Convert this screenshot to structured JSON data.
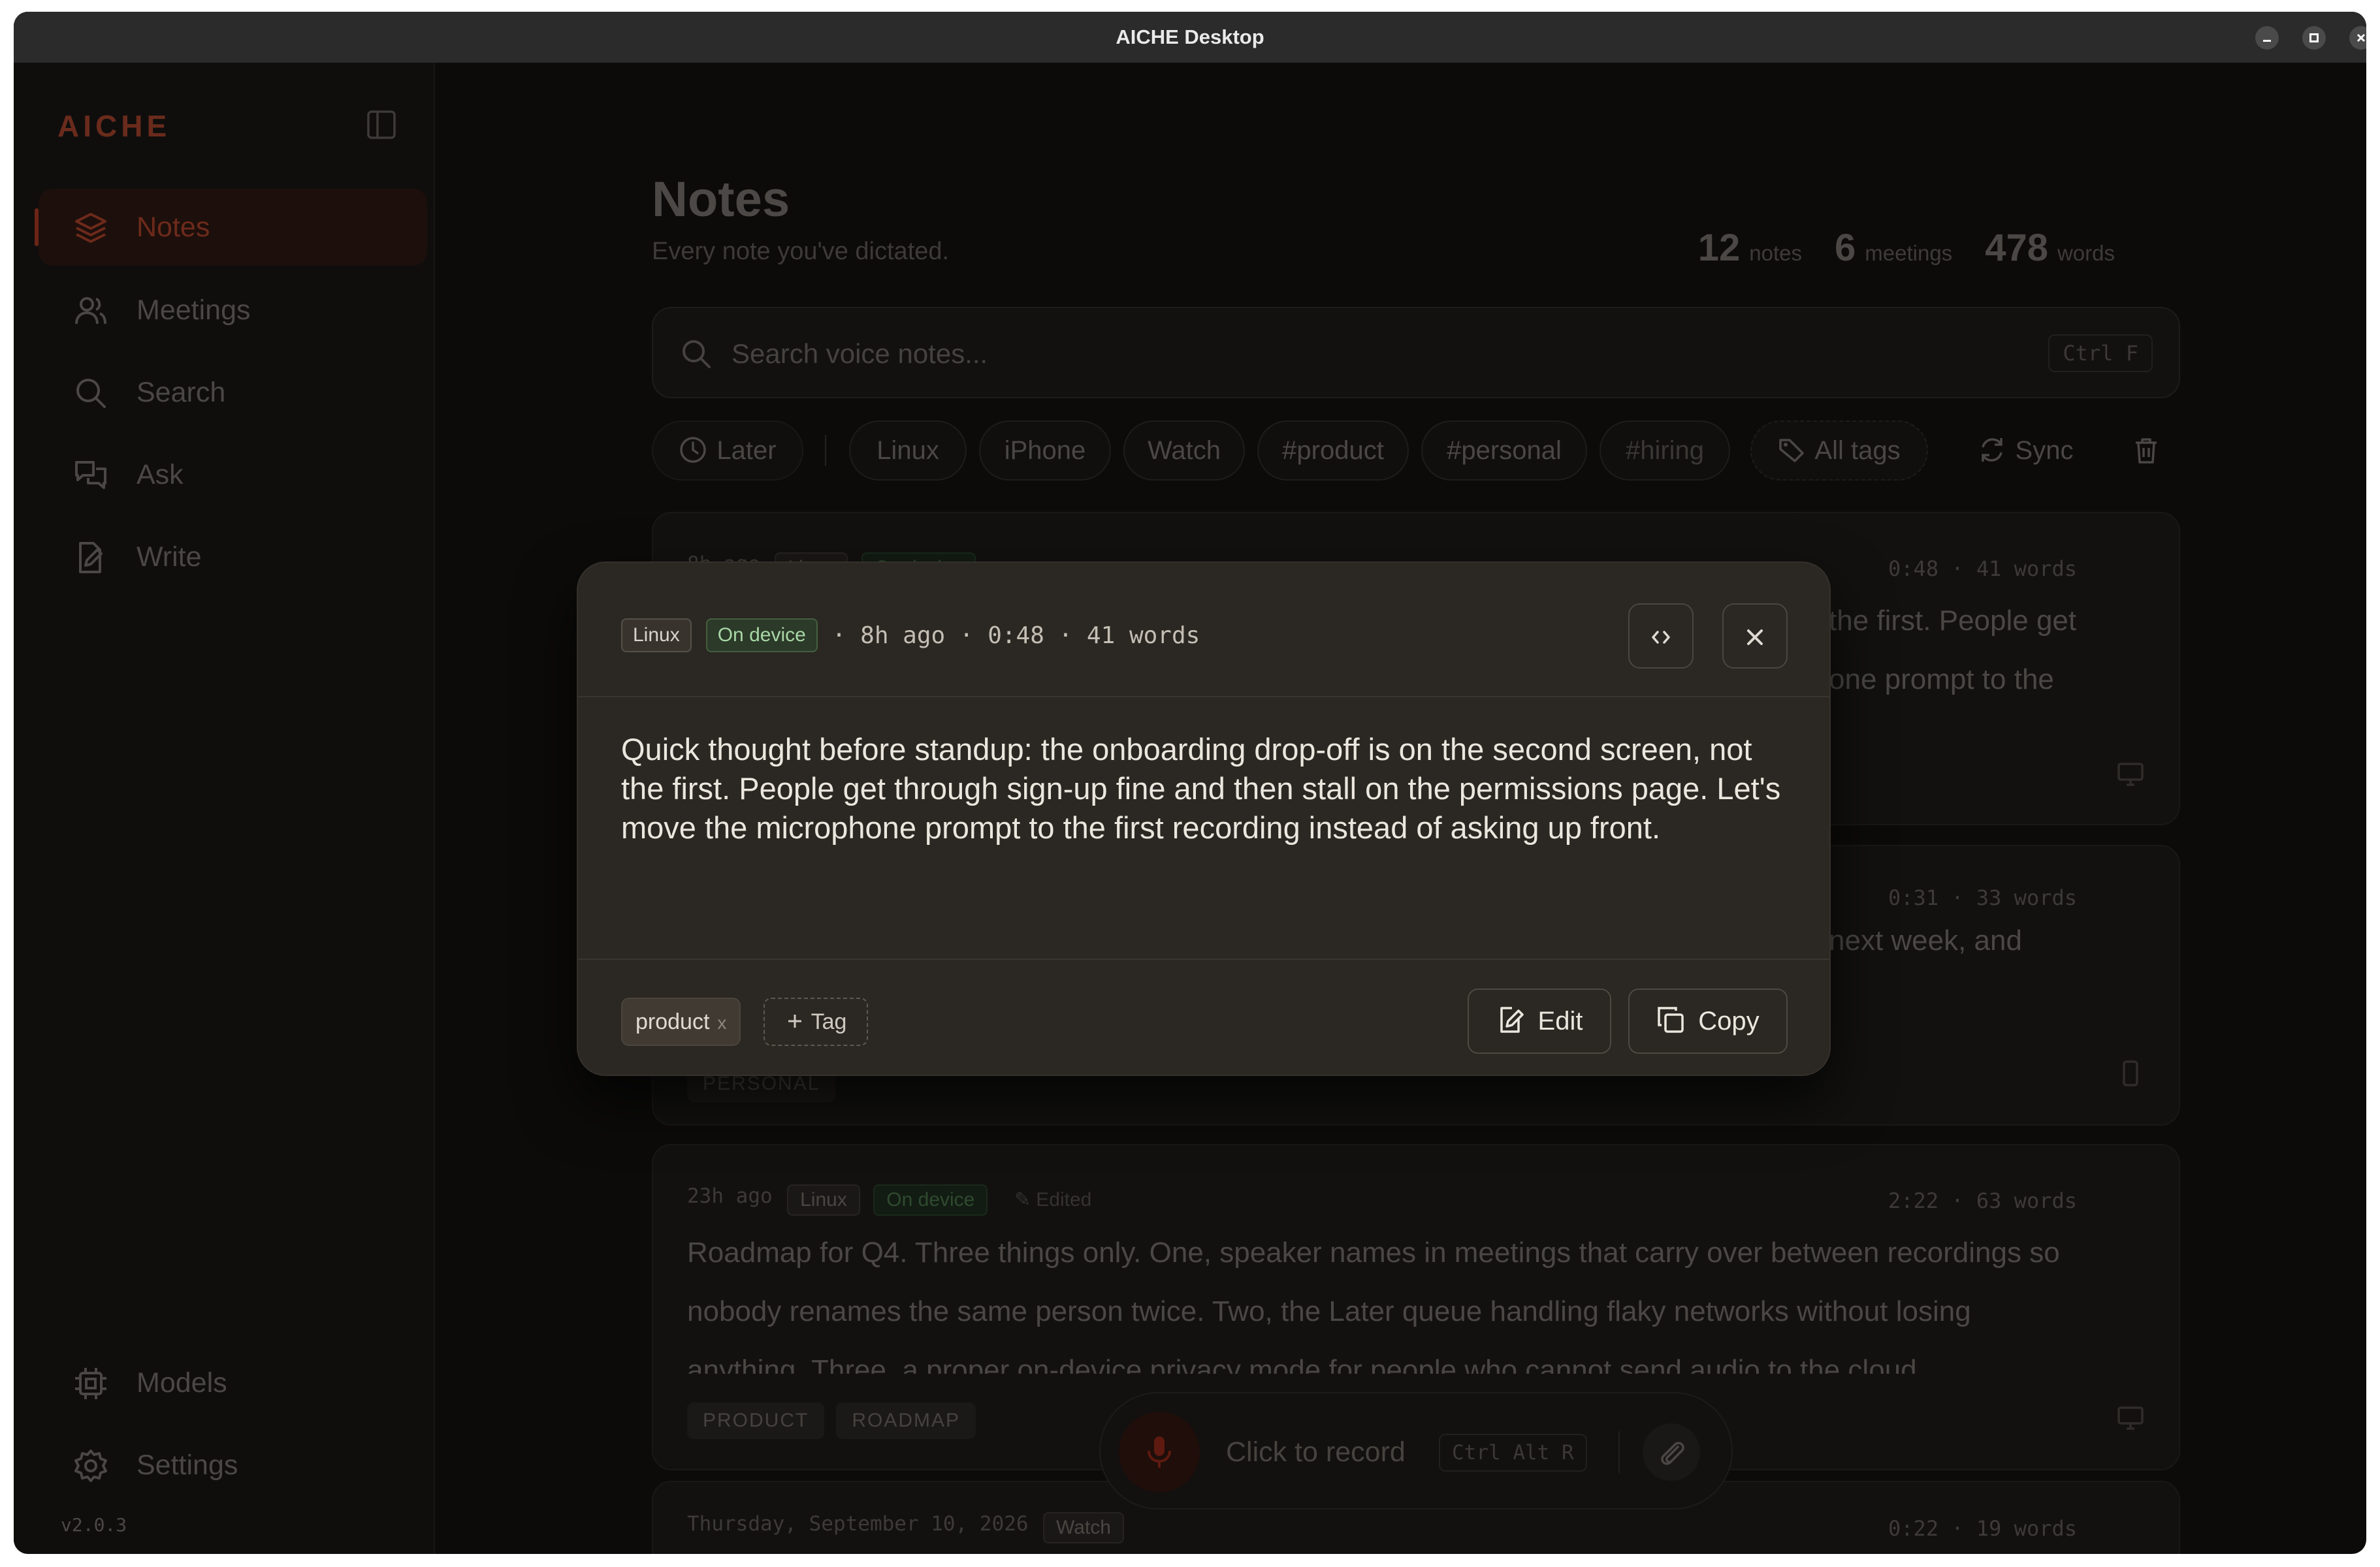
{
  "window": {
    "title": "AICHE Desktop",
    "minimize_label": "–",
    "close_label": "×"
  },
  "sidebar": {
    "logo": "AICHE",
    "items": [
      {
        "label": "Notes",
        "icon": "layers-icon",
        "active": true
      },
      {
        "label": "Meetings",
        "icon": "users-icon",
        "active": false
      },
      {
        "label": "Search",
        "icon": "search-icon",
        "active": false
      },
      {
        "label": "Ask",
        "icon": "chat-icon",
        "active": false
      },
      {
        "label": "Write",
        "icon": "edit-document-icon",
        "active": false
      }
    ],
    "bottom_items": [
      {
        "label": "Models",
        "icon": "chip-icon"
      },
      {
        "label": "Settings",
        "icon": "gear-icon"
      }
    ],
    "version": "v2.0.3"
  },
  "main": {
    "title": "Notes",
    "subtitle": "Every note you've dictated.",
    "stats": {
      "notes_count": "12",
      "notes_label": "notes",
      "meetings_count": "6",
      "meetings_label": "meetings",
      "words_count": "478",
      "words_label": "words"
    },
    "search": {
      "placeholder": "Search voice notes...",
      "shortcut": "Ctrl F"
    },
    "filters": {
      "later": "Later",
      "chips": [
        "Linux",
        "iPhone",
        "Watch",
        "#product",
        "#personal",
        "#hiring"
      ],
      "all_tags": "All tags",
      "sync": "Sync"
    },
    "cards": [
      {
        "time": "8h ago",
        "badges": [
          "Linux",
          "On device"
        ],
        "duration_words": "0:48 · 41 words",
        "text_fragment_1": "the first. People get",
        "text_fragment_2": "one prompt to the"
      },
      {
        "duration_words": "0:31 · 33 words",
        "text_fragment": "next week, and",
        "tag": "PERSONAL"
      },
      {
        "time": "23h ago",
        "badges": [
          "Linux",
          "On device"
        ],
        "edited": "✎ Edited",
        "duration_words": "2:22 · 63 words",
        "text": "Roadmap for Q4. Three things only. One, speaker names in meetings that carry over between recordings so nobody renames the same person twice. Two, the Later queue handling flaky networks without losing anything. Three, a proper on-device privacy mode for people who cannot send audio to the cloud.",
        "tags": [
          "PRODUCT",
          "ROADMAP"
        ]
      },
      {
        "time": "Thursday, September 10, 2026",
        "badges": [
          "Watch"
        ],
        "duration_words": "0:22 · 19 words"
      }
    ]
  },
  "record_bar": {
    "label": "Click to record",
    "shortcut": "Ctrl Alt R"
  },
  "modal": {
    "badges": [
      "Linux",
      "On device"
    ],
    "meta": "· 8h ago · 0:48 · 41 words",
    "body": "Quick thought before standup: the onboarding drop-off is on the second screen, not the first. People get through sign-up fine and then stall on the permissions page. Let's move the microphone prompt to the first recording instead of asking up front.",
    "tag": "product",
    "tag_remove": "x",
    "add_tag": "Tag",
    "edit_label": "Edit",
    "copy_label": "Copy"
  },
  "colors": {
    "accent": "#6d2a1b",
    "modal_bg": "#2b2722",
    "on_device_green": "#a8d7a6"
  }
}
